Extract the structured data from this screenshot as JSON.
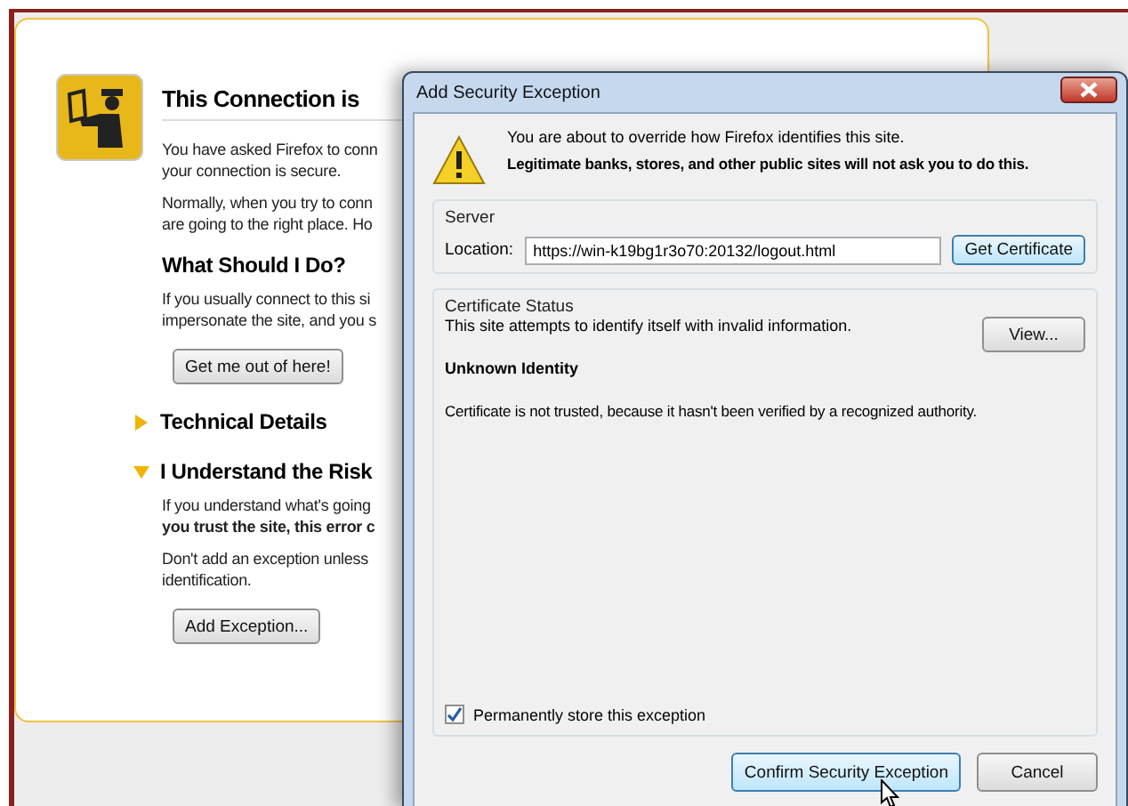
{
  "page": {
    "title": "This Connection is",
    "intro": [
      {
        "lines": [
          "You have asked Firefox to conn",
          "your connection is secure."
        ]
      },
      {
        "lines": [
          "Normally, when you try to conn",
          "are going to the right place. Ho"
        ]
      }
    ],
    "heading": "What Should I Do?",
    "advice": {
      "lines": [
        "If you usually connect to this si",
        "impersonate the site, and you s"
      ]
    },
    "escape_button": "Get me out of here!",
    "sections": [
      {
        "title": "Technical Details",
        "expanded": false
      },
      {
        "title": "I Understand the Risk",
        "expanded": true,
        "paragraphs": [
          {
            "lines": [
              "If you understand what's going",
              "**you trust the site, this error c**"
            ]
          },
          {
            "lines": [
              "Don't add an exception unless",
              "identification."
            ]
          }
        ],
        "button": "Add Exception..."
      }
    ]
  },
  "dialog": {
    "title": "Add Security Exception",
    "message": "You are about to override how Firefox identifies this site.",
    "warning": "Legitimate banks, stores, and other public sites will not ask you to do this.",
    "server": {
      "legend": "Server",
      "location_label": "Location:",
      "location_value": "https://win-k19bg1r3o70:20132/logout.html",
      "button": "Get Certificate"
    },
    "status": {
      "legend": "Certificate Status",
      "text": "This site attempts to identify itself with invalid information.",
      "button": "View...",
      "heading": "Unknown Identity",
      "detail": "Certificate is not trusted, because it hasn't been verified by a recognized authority."
    },
    "permanent": {
      "label": "Permanently store this exception",
      "checked": true
    },
    "buttons": [
      {
        "label": "Confirm Security Exception",
        "focused": true
      },
      {
        "label": "Cancel",
        "focused": false
      }
    ]
  }
}
